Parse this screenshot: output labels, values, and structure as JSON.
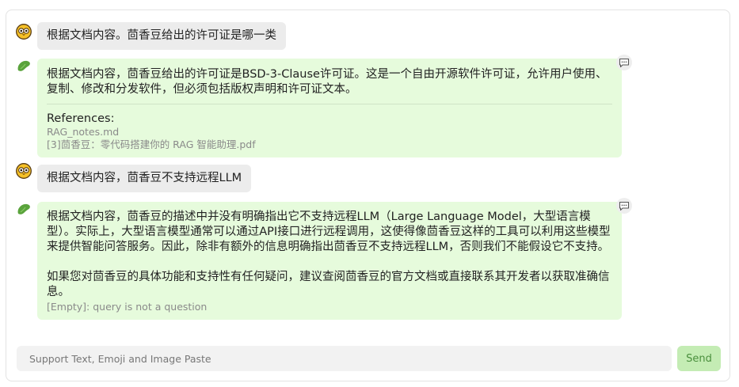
{
  "messages": [
    {
      "role": "user",
      "text": "根据文档内容。茴香豆给出的许可证是哪一类"
    },
    {
      "role": "assistant",
      "text": "根据文档内容，茴香豆给出的许可证是BSD-3-Clause许可证。这是一个自由开源软件许可证，允许用户使用、复制、修改和分发软件，但必须包括版权声明和许可证文本。",
      "references_title": "References:",
      "references": [
        "RAG_notes.md",
        "[3]茴香豆：零代码搭建你的 RAG 智能助理.pdf"
      ]
    },
    {
      "role": "user",
      "text": "根据文档内容，茴香豆不支持远程LLM"
    },
    {
      "role": "assistant",
      "paragraphs": [
        "根据文档内容，茴香豆的描述中并没有明确指出它不支持远程LLM（Large Language Model，大型语言模型）。实际上，大型语言模型通常可以通过API接口进行远程调用，这使得像茴香豆这样的工具可以利用这些模型来提供智能问答服务。因此，除非有额外的信息明确指出茴香豆不支持远程LLM，否则我们不能假设它不支持。",
        "如果您对茴香豆的具体功能和支持性有任何疑问，建议查阅茴香豆的官方文档或直接联系其开发者以获取准确信息。"
      ],
      "note": "[Empty]: query is not a question"
    }
  ],
  "icons": {
    "user_avatar": "owl-face-icon",
    "bot_avatar": "green-bean-icon",
    "comment": "comment-bubble-icon"
  },
  "input": {
    "placeholder": "Support Text, Emoji and Image Paste",
    "value": ""
  },
  "send_label": "Send",
  "colors": {
    "user_bubble": "#ececec",
    "bot_bubble": "#e6fbdc",
    "send_button": "#c4ecb4",
    "send_text": "#4a8f3d",
    "bean_green": "#5aa33c"
  }
}
